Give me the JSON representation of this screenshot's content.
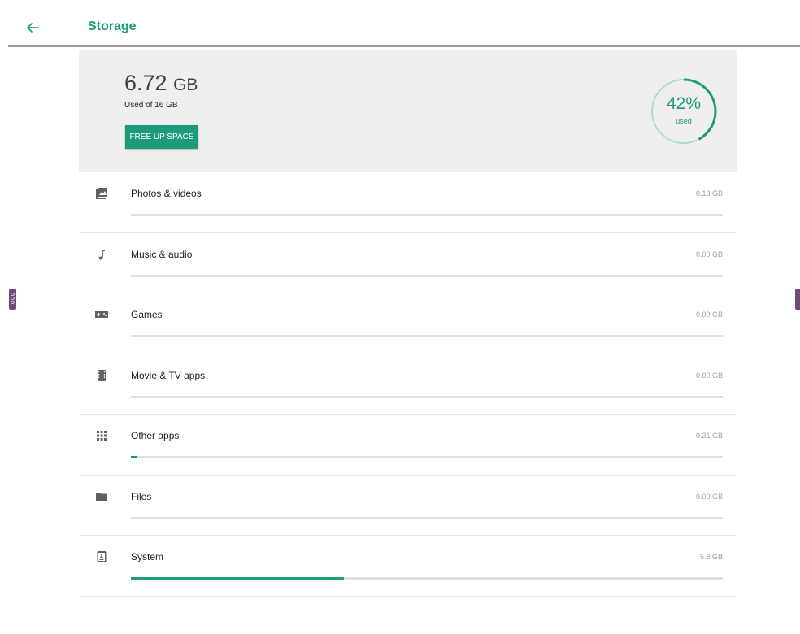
{
  "header": {
    "title": "Storage",
    "back_icon": "arrow-back-icon"
  },
  "summary": {
    "used_value": "6.72",
    "used_unit": "GB",
    "used_of": "Used of 16 GB",
    "free_button": "FREE UP SPACE",
    "percent_label": "42%",
    "percent_sub": "used",
    "percent_used": 0.42
  },
  "categories": [
    {
      "label": "Photos & videos",
      "size": "0.13 GB",
      "fraction": 0.0,
      "icon": "photo-icon"
    },
    {
      "label": "Music & audio",
      "size": "0.00 GB",
      "fraction": 0.0,
      "icon": "music-note-icon"
    },
    {
      "label": "Games",
      "size": "0.00 GB",
      "fraction": 0.0,
      "icon": "gamepad-icon"
    },
    {
      "label": "Movie & TV apps",
      "size": "0.00 GB",
      "fraction": 0.0,
      "icon": "movie-icon"
    },
    {
      "label": "Other apps",
      "size": "0.31 GB",
      "fraction": 0.01,
      "icon": "apps-grid-icon"
    },
    {
      "label": "Files",
      "size": "0.00 GB",
      "fraction": 0.0,
      "icon": "folder-icon"
    },
    {
      "label": "System",
      "size": "5.8 GB",
      "fraction": 0.36,
      "icon": "system-update-icon"
    }
  ],
  "colors": {
    "accent": "#1d9a77",
    "ring_track": "#a9ddd0",
    "side_tab": "#6b4c7a"
  }
}
